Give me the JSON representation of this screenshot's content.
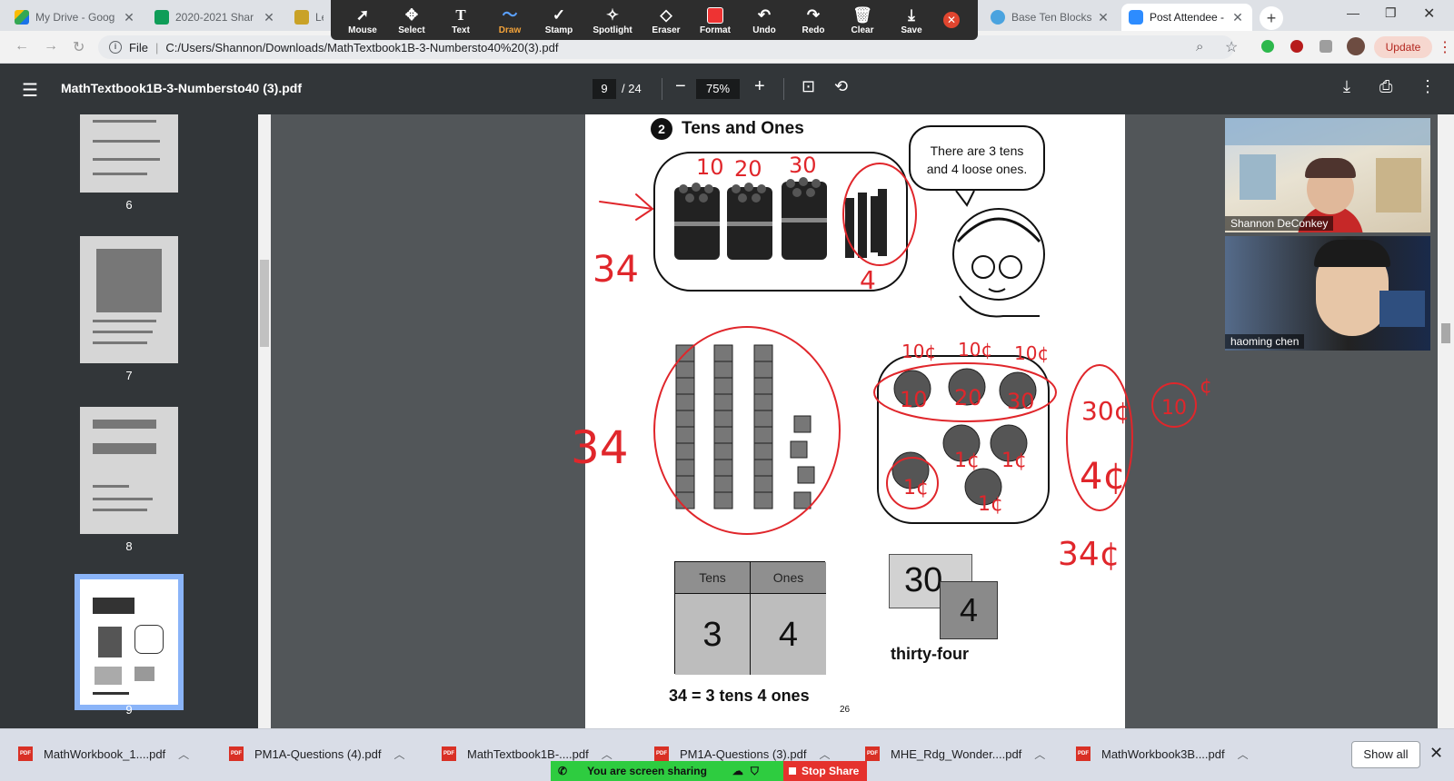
{
  "browser": {
    "tabs": [
      {
        "title": "My Drive - Goog",
        "fav_color": "#1a73e8"
      },
      {
        "title": "2020-2021 Shar",
        "fav_color": "#0f9d58"
      },
      {
        "title": "Les",
        "fav_color": "#c9a227"
      },
      {
        "title": "Base Ten Blocks",
        "fav_color": "#4aa3df"
      },
      {
        "title": "Post Attendee -",
        "fav_color": "#2d8cff"
      }
    ],
    "address_label": "File",
    "url": "C:/Users/Shannon/Downloads/MathTextbook1B-3-Numbersto40%20(3).pdf",
    "update_label": "Update"
  },
  "annotate": {
    "tools": [
      {
        "label": "Mouse",
        "icon": "cursor-icon",
        "glyph": "➚"
      },
      {
        "label": "Select",
        "icon": "move-icon",
        "glyph": "✥"
      },
      {
        "label": "Text",
        "icon": "text-icon",
        "glyph": "T"
      },
      {
        "label": "Draw",
        "icon": "draw-icon",
        "glyph": "〜"
      },
      {
        "label": "Stamp",
        "icon": "stamp-icon",
        "glyph": "✓"
      },
      {
        "label": "Spotlight",
        "icon": "spotlight-icon",
        "glyph": "✧"
      },
      {
        "label": "Eraser",
        "icon": "eraser-icon",
        "glyph": "◇"
      },
      {
        "label": "Format",
        "icon": "format-icon",
        "glyph": ""
      },
      {
        "label": "Undo",
        "icon": "undo-icon",
        "glyph": "↶"
      },
      {
        "label": "Redo",
        "icon": "redo-icon",
        "glyph": "↷"
      },
      {
        "label": "Clear",
        "icon": "trash-icon",
        "glyph": "🗑"
      },
      {
        "label": "Save",
        "icon": "save-icon",
        "glyph": "⤓"
      }
    ],
    "selected": "Draw",
    "format_color": "#e8302a"
  },
  "viewer": {
    "title": "MathTextbook1B-3-Numbersto40 (3).pdf",
    "page": "9",
    "total": "/ 24",
    "zoom": "75%"
  },
  "sidebar": {
    "pages": [
      "6",
      "7",
      "8",
      "9"
    ],
    "selected": "9"
  },
  "page": {
    "section_num": "2",
    "section_title": "Tens and Ones",
    "bubble_line1": "There are 3 tens",
    "bubble_line2": "and 4 loose ones.",
    "table_head_tens": "Tens",
    "table_head_ones": "Ones",
    "table_tens": "3",
    "table_ones": "4",
    "equation": "34 = 3 tens 4 ones",
    "card_tens": "30",
    "card_ones": "4",
    "word": "thirty-four",
    "page_number": "26"
  },
  "annotations": {
    "counts": [
      "10",
      "20",
      "30"
    ],
    "result": "34",
    "loose": "4",
    "coin_labels_top": [
      "10¢",
      "10¢",
      "10¢"
    ],
    "coin_marks": [
      "10",
      "20",
      "30"
    ],
    "coin_loose": [
      "1¢",
      "1¢",
      "1¢",
      "1¢"
    ],
    "side_tens": "30¢",
    "side_ones": "4¢",
    "side_total": "34¢",
    "dime": "10",
    "dime_unit": "¢"
  },
  "participants": [
    {
      "name": "Shannon DeConkey"
    },
    {
      "name": "haoming chen"
    }
  ],
  "downloads": [
    "MathWorkbook_1....pdf",
    "PM1A-Questions (4).pdf",
    "MathTextbook1B-....pdf",
    "PM1A-Questions (3).pdf",
    "MHE_Rdg_Wonder....pdf",
    "MathWorkbook3B....pdf"
  ],
  "downloads_show_all": "Show all",
  "share": {
    "status": "You are screen sharing",
    "stop": "Stop Share"
  }
}
